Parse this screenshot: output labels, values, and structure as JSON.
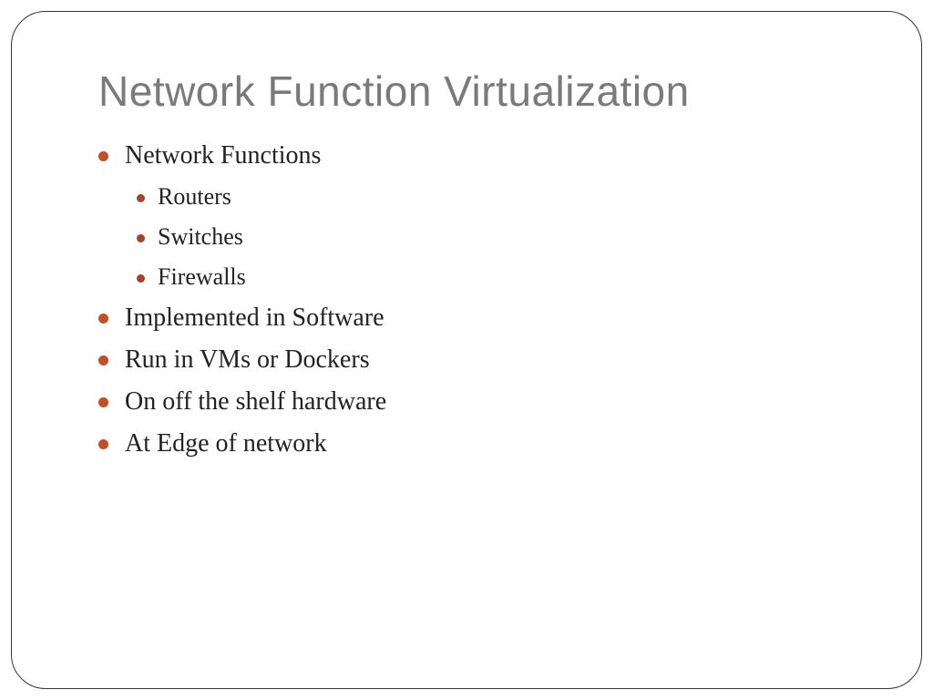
{
  "slide": {
    "title": "Network Function Virtualization",
    "bullets": {
      "b0": "Network Functions",
      "b0_0": "Routers",
      "b0_1": "Switches",
      "b0_2": "Firewalls",
      "b1": "Implemented in Software",
      "b2": "Run in VMs or Dockers",
      "b3": "On off the shelf hardware",
      "b4": "At Edge of network"
    }
  }
}
